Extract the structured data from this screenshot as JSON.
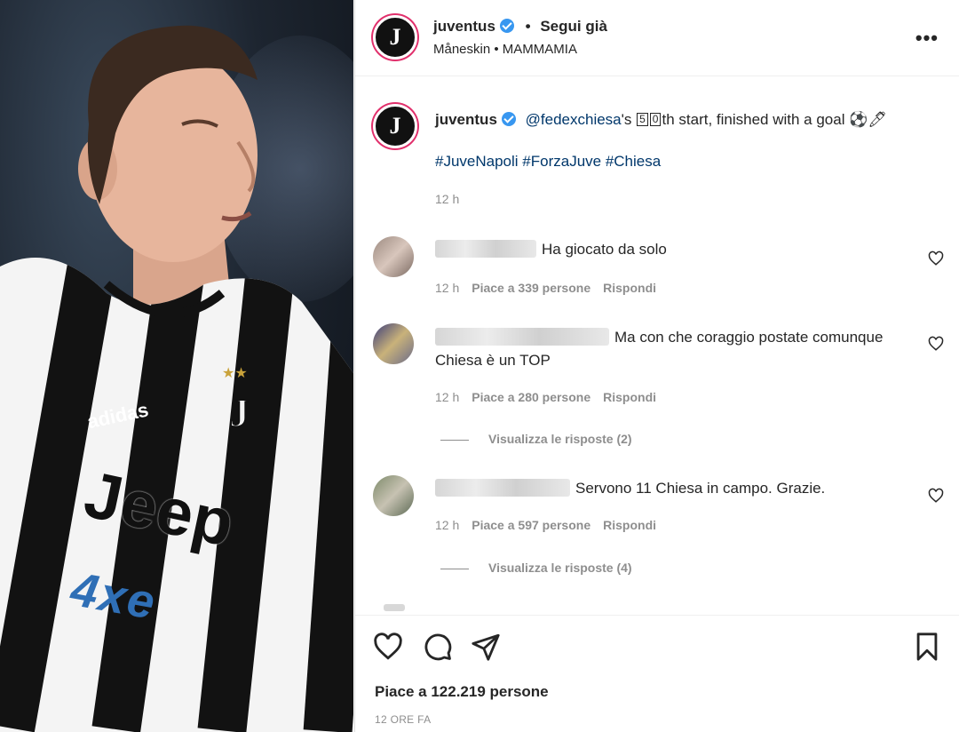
{
  "header": {
    "username": "juventus",
    "follow_status": "Segui già",
    "separator": "•",
    "audio": "Måneskin • MAMMAMIA",
    "more_icon": "more-options-icon"
  },
  "caption": {
    "username": "juventus",
    "mention": "@fedexchiesa",
    "text_before_boxes": "'s ",
    "box_1": "5",
    "box_2": "0",
    "text_after": "th start, finished with a goal ⚽🖊",
    "hashtags": "#JuveNapoli #ForzaJuve #Chiesa",
    "time": "12 h"
  },
  "comments": [
    {
      "text": "Ha giocato da solo",
      "time": "12 h",
      "likes": "Piace a 339 persone",
      "reply": "Rispondi"
    },
    {
      "text": "Ma con che coraggio postate comunque Chiesa è un TOP",
      "time": "12 h",
      "likes": "Piace a 280 persone",
      "reply": "Rispondi",
      "view_replies": "Visualizza le risposte (2)"
    },
    {
      "text": "Servono 11 Chiesa in campo. Grazie.",
      "time": "12 h",
      "likes": "Piace a 597 persone",
      "reply": "Rispondi",
      "view_replies": "Visualizza le risposte (4)"
    }
  ],
  "actions": {
    "likes": "Piace a 122.219 persone",
    "posted_ago": "12 ORE FA"
  },
  "media": {
    "sponsor_text": "Jeep",
    "kit_text": "4xe"
  },
  "colors": {
    "link": "#00376b",
    "muted": "#8e8e8e",
    "verified": "#3897f0"
  }
}
